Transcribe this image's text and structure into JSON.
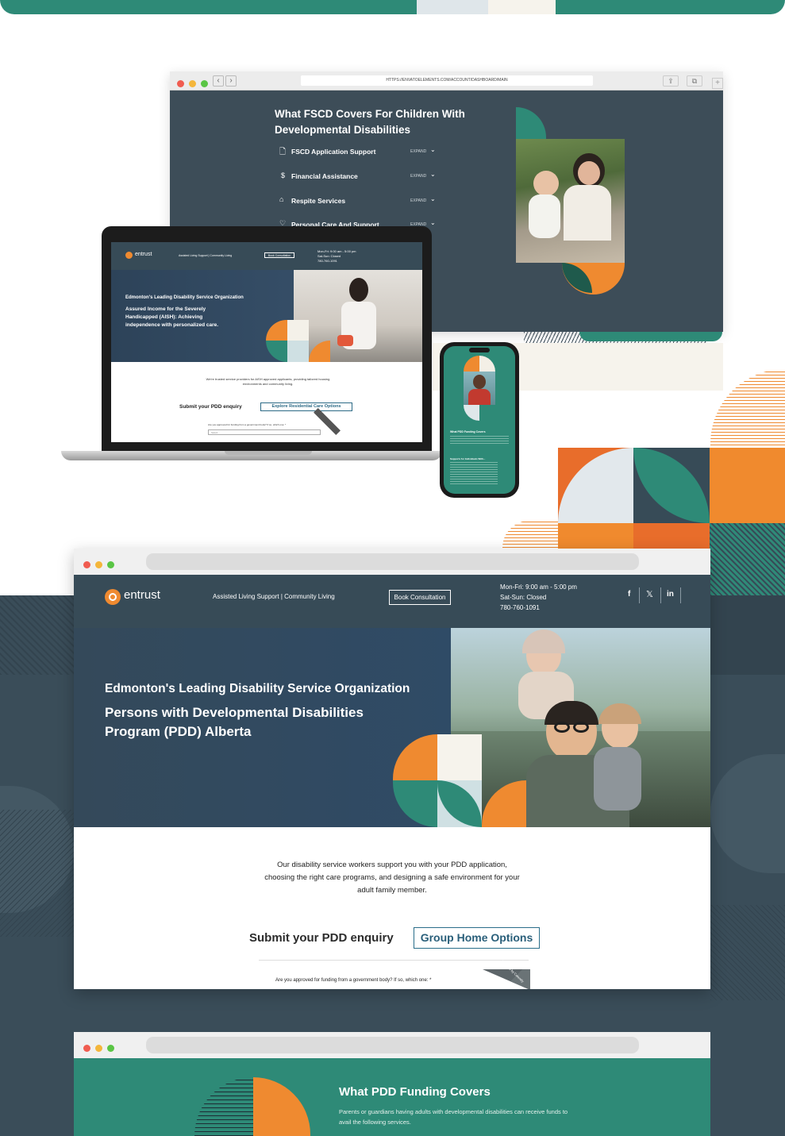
{
  "top_browser": {
    "url": "HTTPS://ENVATOELEMENTS.COM/ACCOUNT/DASHBOARD/MAIN",
    "title": "What FSCD Covers For Children With Developmental Disabilities",
    "expand_label": "EXPAND",
    "items": [
      {
        "label": "FSCD Application Support",
        "icon": "document-icon"
      },
      {
        "label": "Financial Assistance",
        "icon": "dollar-icon"
      },
      {
        "label": "Respite Services",
        "icon": "home-icon"
      },
      {
        "label": "Personal Care And Support",
        "icon": "care-icon"
      }
    ]
  },
  "laptop": {
    "logo": "entrust",
    "nav": "Assisted Living Support | Community Living",
    "book": "Book Consultation",
    "hours": "Mon-Fri: 9:00 am - 5:00 pm",
    "weekend": "Sat-Sun: Closed",
    "phone": "780-760-1091",
    "eyebrow": "Edmonton's Leading Disability Service Organization",
    "headline": "Assured Income for the Severely Handicapped (AISH): Achieving independence with personalized care.",
    "body": "We're trusted service providers for AISH approved applicants, providing tailored housing environments and community living.",
    "submit": "Submit your PDD enquiry",
    "explore": "Explore Residential Care Options",
    "question": "Are you approved for funding from a government body? If so, which one: *",
    "select": "Select..."
  },
  "phone": {
    "title": "What PDD Funding Covers",
    "section": "Supports for Individuals With..."
  },
  "main_browser": {
    "logo": "entrust",
    "nav": "Assisted Living Support | Community Living",
    "book": "Book Consultation",
    "hours": "Mon-Fri: 9:00 am - 5:00 pm",
    "weekend": "Sat-Sun: Closed",
    "phone": "780-760-1091",
    "social": [
      "f",
      "𝕏",
      "in"
    ],
    "eyebrow": "Edmonton's Leading Disability Service Organization",
    "headline_1": "Persons with Developmental Disabilities",
    "headline_2": "Program (PDD) Alberta",
    "body_1": "Our disability service workers support you with your PDD application,",
    "body_2": "choosing the right care programs, and designing a safe environment for your",
    "body_3": "adult family member.",
    "submit": "Submit your PDD enquiry",
    "group_home": "Group Home Options",
    "question": "Are you approved for funding from a government body? If so, which one: *",
    "badge": "Powered by Calendly"
  },
  "bottom_browser": {
    "title": "What PDD Funding Covers",
    "body_1": "Parents or guardians having adults with developmental disabilities can receive funds to",
    "body_2": "avail the following services."
  },
  "colors": {
    "teal": "#2e8a77",
    "navy": "#374b57",
    "orange": "#ef8a30",
    "cream": "#f6f3ec"
  }
}
